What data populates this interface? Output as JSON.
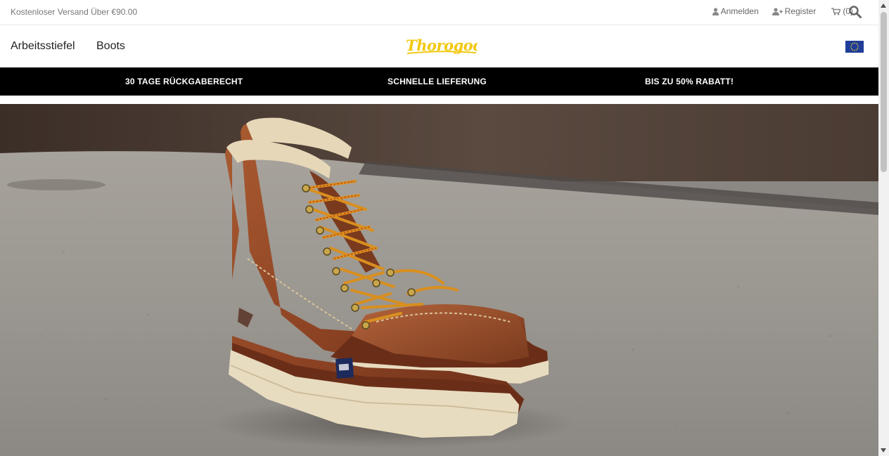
{
  "topbar": {
    "promo": "Kostenloser Versand Über €90.00",
    "login_label": "Anmelden",
    "register_label": "Register",
    "cart_label": "(0)"
  },
  "nav": {
    "items": [
      {
        "label": "Arbeitsstiefel"
      },
      {
        "label": "Boots"
      }
    ],
    "logo_text": "Thorogood"
  },
  "usp": {
    "items": [
      {
        "label": "30 TAGE RÜCKGABERECHT"
      },
      {
        "label": "SCHNELLE LIEFERUNG"
      },
      {
        "label": "BIS ZU 50% RABATT!"
      }
    ]
  },
  "icons": {
    "login": "user-icon",
    "register": "user-plus-icon",
    "cart": "cart-icon",
    "search": "search-icon",
    "region": "eu-flag-icon"
  },
  "colors": {
    "usp_bar": "#000000",
    "logo": "#f2c80f",
    "flag": "#1f3d99",
    "boot_leather": "#8e4424",
    "sole": "#e8dcc0"
  }
}
